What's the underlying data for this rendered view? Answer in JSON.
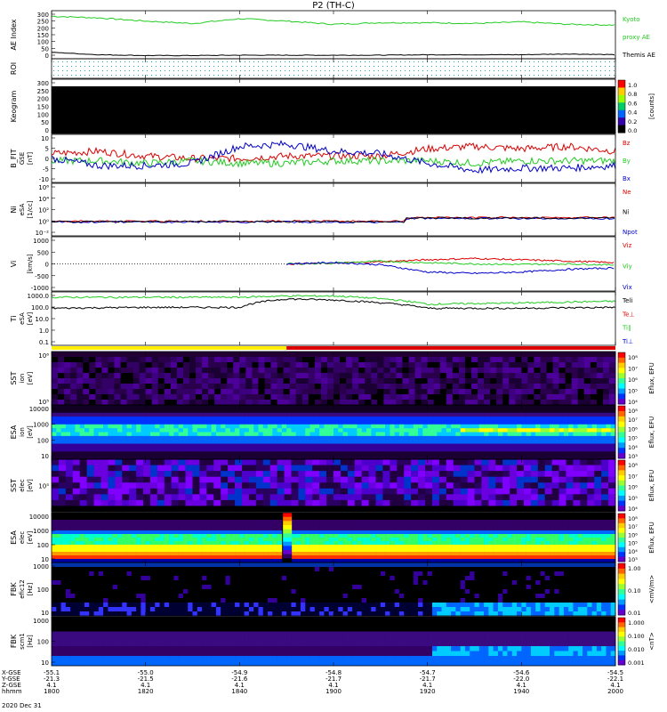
{
  "title": "P2 (TH-C)",
  "panels": {
    "ae": {
      "ylabel": "AE Index",
      "ticks": [
        "300",
        "250",
        "200",
        "150",
        "100",
        "50",
        "0"
      ],
      "legend": [
        {
          "text": "Kyoto",
          "color": "#22cc22"
        },
        {
          "text": "proxy AE",
          "color": "#22cc22"
        },
        {
          "text": "Themis AE",
          "color": "#000000"
        }
      ]
    },
    "roi": {
      "ylabel": "ROI"
    },
    "keogram": {
      "ylabel": "Keogram",
      "ticks": [
        "300",
        "250",
        "200",
        "150",
        "100",
        "50",
        "0"
      ],
      "cb_ticks": [
        "1.0",
        "0.8",
        "0.6",
        "0.4",
        "0.2",
        "0.0"
      ],
      "cb_label": "[counts]"
    },
    "bfit": {
      "ylabel": "B_FIT",
      "sub": "GSE",
      "unit": "[nT]",
      "ticks": [
        "10",
        "5",
        "0",
        "-5",
        "-10"
      ],
      "legend": [
        {
          "text": "Bz",
          "color": "#dd0000"
        },
        {
          "text": "By",
          "color": "#22cc22"
        },
        {
          "text": "Bx",
          "color": "#0000cc"
        }
      ]
    },
    "ni": {
      "ylabel": "Ni",
      "sub": "eSA",
      "unit": "[1/cc]",
      "ticks": [
        "10⁶",
        "10⁴",
        "10²",
        "10⁰",
        "10⁻²"
      ],
      "legend": [
        {
          "text": "Ne",
          "color": "#dd0000"
        },
        {
          "text": "Ni",
          "color": "#000000"
        },
        {
          "text": "Npot",
          "color": "#0000cc"
        }
      ]
    },
    "vi": {
      "ylabel": "Vi",
      "unit": "[km/s]",
      "ticks": [
        "1000",
        "500",
        "0",
        "-500",
        "-1000"
      ],
      "legend": [
        {
          "text": "Viz",
          "color": "#dd0000"
        },
        {
          "text": "Viy",
          "color": "#22cc22"
        },
        {
          "text": "Vix",
          "color": "#0000cc"
        }
      ]
    },
    "ti": {
      "ylabel": "Ti",
      "sub": "eSA",
      "unit": "[eV]",
      "ticks": [
        "1000.0",
        "100.0",
        "10.0",
        "1.0",
        "0.1"
      ],
      "legend": [
        {
          "text": "Teli",
          "color": "#000000"
        },
        {
          "text": "Te⊥",
          "color": "#dd0000"
        },
        {
          "text": "Ti∥",
          "color": "#22cc22"
        },
        {
          "text": "Ti⊥",
          "color": "#0000cc"
        }
      ]
    },
    "sst_i": {
      "ylabel": "SST",
      "sub": "ion",
      "unit": "[eV]",
      "ticks": [
        "10⁶",
        "10⁵"
      ],
      "cb_ticks": [
        "10⁸",
        "10⁷",
        "10⁶",
        "10⁵",
        "10⁴"
      ],
      "cb_label": "Eflux, EFU"
    },
    "esa_i": {
      "ylabel": "ESA",
      "sub": "ion",
      "unit": "[eV]",
      "ticks": [
        "10000",
        "1000",
        "100",
        "10"
      ],
      "cb_ticks": [
        "10⁸",
        "10⁷",
        "10⁶",
        "10⁵",
        "10⁴",
        "10³"
      ],
      "cb_label": "Eflux, EFU"
    },
    "sst_e": {
      "ylabel": "SST",
      "sub": "elec",
      "unit": "[eV]",
      "ticks": [
        "10⁵"
      ],
      "cb_ticks": [
        "10⁸",
        "10⁷",
        "10⁶",
        "10⁵",
        "10⁴"
      ],
      "cb_label": "Eflux, EFU"
    },
    "esa_e": {
      "ylabel": "ESA",
      "sub": "elec",
      "unit": "[eV]",
      "ticks": [
        "10000",
        "1000",
        "100",
        "10"
      ],
      "cb_ticks": [
        "10⁸",
        "10⁷",
        "10⁶",
        "10⁵",
        "10⁴",
        "10³"
      ],
      "cb_label": "Eflux, EFU"
    },
    "fbk1": {
      "ylabel": "FBK",
      "sub": "efic12",
      "unit": "[Hz]",
      "ticks": [
        "1000",
        "100",
        "10"
      ],
      "cb_ticks": [
        "1.00",
        "0.10",
        "0.01"
      ],
      "cb_label": "<mV/m>"
    },
    "fbk2": {
      "ylabel": "FBK",
      "sub": "scm1",
      "unit": "[Hz]",
      "ticks": [
        "1000",
        "100",
        "10"
      ],
      "cb_ticks": [
        "1.000",
        "0.100",
        "0.010",
        "0.001"
      ],
      "cb_label": "<nT>"
    }
  },
  "xaxis": {
    "row_labels": [
      "X-GSE",
      "Y-GSE",
      "Z-GSE",
      "hhmm",
      "2020 Dec 31"
    ],
    "ticks": [
      {
        "x": "-55.1",
        "y": "-21.3",
        "z": "4.1",
        "t": "1800"
      },
      {
        "x": "-55.0",
        "y": "-21.5",
        "z": "4.1",
        "t": "1820"
      },
      {
        "x": "-54.9",
        "y": "-21.6",
        "z": "4.1",
        "t": "1840"
      },
      {
        "x": "-54.8",
        "y": "-21.7",
        "z": "4.1",
        "t": "1900"
      },
      {
        "x": "-54.7",
        "y": "-21.7",
        "z": "4.1",
        "t": "1920"
      },
      {
        "x": "-54.6",
        "y": "-22.0",
        "z": "4.1",
        "t": "1940"
      },
      {
        "x": "-54.5",
        "y": "-22.1",
        "z": "4.1",
        "t": "2000"
      }
    ]
  },
  "colors": {
    "kyoto": "#22cc22",
    "themis": "#000000",
    "red": "#dd0000",
    "green": "#22cc22",
    "blue": "#0000cc",
    "mode_slow": "#ffee00",
    "mode_fast": "#dd0000"
  },
  "chart_data": {
    "type": "line",
    "x_range_hhmm": [
      "1800",
      "2000"
    ],
    "mode_bar": [
      {
        "from": "1800",
        "to": "1850",
        "mode": "slow survey",
        "color": "#ffee00"
      },
      {
        "from": "1850",
        "to": "2000",
        "mode": "fast survey",
        "color": "#dd0000"
      }
    ],
    "ae": {
      "ylim": [
        0,
        300
      ],
      "series": [
        {
          "name": "Kyoto proxy AE",
          "x": [
            "1800",
            "1810",
            "1820",
            "1830",
            "1840",
            "1850",
            "1900",
            "1910",
            "1920",
            "1930",
            "1940",
            "1950",
            "2000"
          ],
          "values": [
            265,
            255,
            235,
            220,
            250,
            235,
            215,
            225,
            225,
            220,
            230,
            215,
            210
          ]
        },
        {
          "name": "Themis AE",
          "x": [
            "1800",
            "1810",
            "1820",
            "1830",
            "1840",
            "1850",
            "1900",
            "1910",
            "1920",
            "1930",
            "1940",
            "1950",
            "2000"
          ],
          "values": [
            40,
            25,
            20,
            20,
            22,
            22,
            22,
            22,
            25,
            25,
            25,
            30,
            25
          ]
        }
      ]
    },
    "bfit": {
      "ylim": [
        -10,
        10
      ],
      "series": [
        {
          "name": "Bz",
          "x": [
            "1800",
            "1810",
            "1820",
            "1830",
            "1840",
            "1850",
            "1900",
            "1910",
            "1920",
            "1930",
            "1940",
            "1950",
            "2000"
          ],
          "values": [
            2,
            3,
            1,
            0,
            0,
            1,
            1,
            1,
            4,
            5,
            4,
            5,
            3
          ]
        },
        {
          "name": "By",
          "x": [
            "1800",
            "1810",
            "1820",
            "1830",
            "1840",
            "1850",
            "1900",
            "1910",
            "1920",
            "1930",
            "1940",
            "1950",
            "2000"
          ],
          "values": [
            -1,
            -1,
            -2,
            -1,
            -2,
            -2,
            -1,
            -1,
            -1,
            -2,
            -1,
            -1,
            -1
          ]
        },
        {
          "name": "Bx",
          "x": [
            "1800",
            "1810",
            "1820",
            "1830",
            "1840",
            "1850",
            "1900",
            "1910",
            "1920",
            "1930",
            "1940",
            "1950",
            "2000"
          ],
          "values": [
            0,
            -3,
            -3,
            -2,
            5,
            6,
            3,
            2,
            -2,
            -5,
            -4,
            -4,
            -3
          ]
        }
      ]
    },
    "vi": {
      "ylim": [
        -1000,
        1000
      ],
      "series": [
        {
          "name": "Viz",
          "x": [
            "1850",
            "1900",
            "1910",
            "1920",
            "1930",
            "1940",
            "1950",
            "2000"
          ],
          "values": [
            0,
            20,
            80,
            150,
            200,
            150,
            100,
            50
          ]
        },
        {
          "name": "Viy",
          "x": [
            "1850",
            "1900",
            "1910",
            "1920",
            "1930",
            "1940",
            "1950",
            "2000"
          ],
          "values": [
            0,
            30,
            100,
            40,
            0,
            -20,
            0,
            -40
          ]
        },
        {
          "name": "Vix",
          "x": [
            "1850",
            "1900",
            "1910",
            "1920",
            "1930",
            "1940",
            "1950",
            "2000"
          ],
          "values": [
            0,
            50,
            -30,
            -300,
            -350,
            -300,
            -200,
            -150
          ]
        }
      ]
    },
    "ti": {
      "ylim": [
        0.1,
        1000
      ],
      "series": [
        {
          "name": "Ti∥",
          "x": [
            "1800",
            "1820",
            "1840",
            "1850",
            "1900",
            "1920",
            "1940",
            "2000"
          ],
          "values": [
            400,
            400,
            400,
            500,
            500,
            120,
            150,
            200
          ]
        },
        {
          "name": "Teli",
          "x": [
            "1800",
            "1820",
            "1840",
            "1850",
            "1900",
            "1920",
            "1940",
            "2000"
          ],
          "values": [
            60,
            70,
            70,
            300,
            250,
            60,
            60,
            70
          ]
        }
      ]
    }
  }
}
